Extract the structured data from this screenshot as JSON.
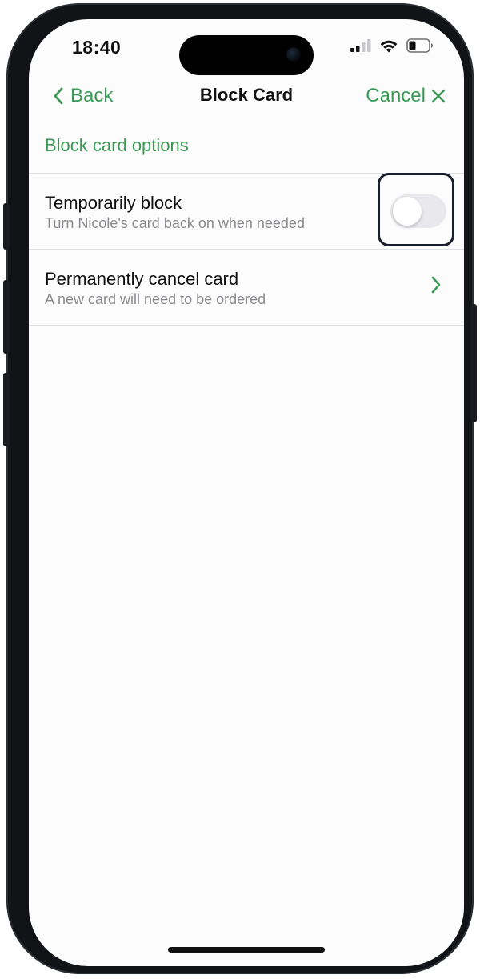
{
  "status_bar": {
    "time": "18:40",
    "icons": [
      "cellular-signal-icon",
      "wifi-icon",
      "battery-icon"
    ]
  },
  "nav": {
    "back_label": "Back",
    "title": "Block Card",
    "cancel_label": "Cancel"
  },
  "section": {
    "header": "Block card options"
  },
  "options": [
    {
      "title": "Temporarily block",
      "subtitle": "Turn Nicole's card back on when needed",
      "control": "toggle",
      "toggle_on": false
    },
    {
      "title": "Permanently cancel card",
      "subtitle": "A new card will need to be ordered",
      "control": "chevron-right-icon"
    }
  ],
  "colors": {
    "accent": "#3a9a55",
    "text_primary": "#111111",
    "text_secondary": "#8a8a8e",
    "background": "#fdfcfd",
    "toggle_off": "#e9e8ec",
    "focus_ring": "#1a1f2e"
  }
}
